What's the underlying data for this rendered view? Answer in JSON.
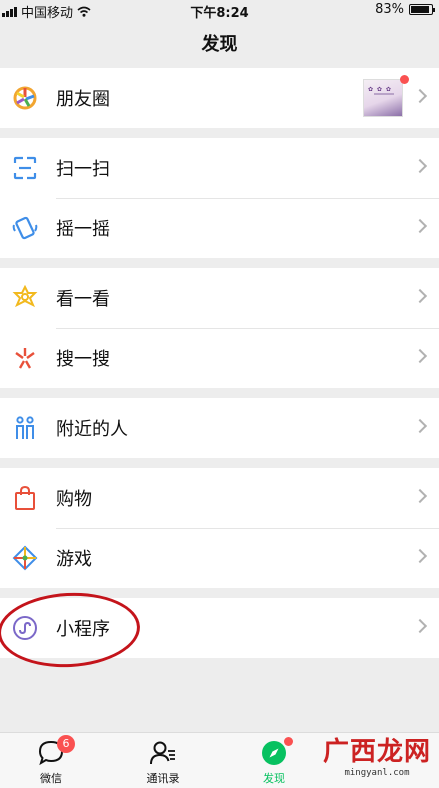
{
  "status_bar": {
    "carrier": "中国移动",
    "time": "下午8:24",
    "battery": "83%",
    "battery_level": 0.83
  },
  "nav": {
    "title": "发现"
  },
  "groups": [
    {
      "items": [
        {
          "label": "朋友圈",
          "icon": "moments-icon"
        }
      ]
    },
    {
      "items": [
        {
          "label": "扫一扫",
          "icon": "scan-icon"
        },
        {
          "label": "摇一摇",
          "icon": "shake-icon"
        }
      ]
    },
    {
      "items": [
        {
          "label": "看一看",
          "icon": "top-stories-icon"
        },
        {
          "label": "搜一搜",
          "icon": "search-icon"
        }
      ]
    },
    {
      "items": [
        {
          "label": "附近的人",
          "icon": "people-nearby-icon"
        }
      ]
    },
    {
      "items": [
        {
          "label": "购物",
          "icon": "shopping-bag-icon"
        },
        {
          "label": "游戏",
          "icon": "games-icon"
        }
      ]
    },
    {
      "items": [
        {
          "label": "小程序",
          "icon": "mini-programs-icon"
        }
      ]
    }
  ],
  "tabbar": {
    "tabs": [
      {
        "label": "微信",
        "icon": "chat-bubble-icon",
        "badge": "6"
      },
      {
        "label": "通讯录",
        "icon": "contacts-icon"
      },
      {
        "label": "发现",
        "icon": "compass-icon",
        "active": true
      }
    ]
  },
  "watermark": {
    "title": "广西龙网",
    "url": "mingyanl.com"
  },
  "colors": {
    "accent": "#07c160",
    "badge": "#fa5151",
    "annotation_circle": "#c4141b",
    "background": "#ededed"
  }
}
